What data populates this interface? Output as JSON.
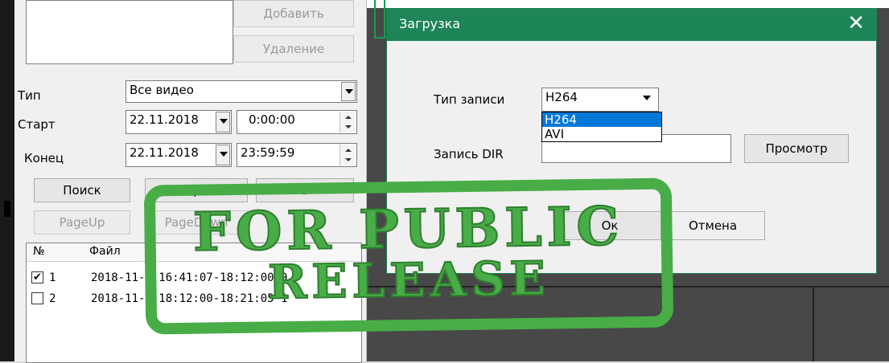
{
  "left_panel": {
    "add_button": "Добавить",
    "delete_button": "Удаление",
    "type_label": "Тип",
    "type_value": "Все видео",
    "start_label": "Старт",
    "start_date": "22.11.2018",
    "start_time": "0:00:00",
    "end_label": "Конец",
    "end_date": "22.11.2018",
    "end_time": "23:59:59",
    "search_button": "Поиск",
    "play_button": "Воспроизв",
    "third_button": "В",
    "page_up": "PageUp",
    "page_down": "PageDown",
    "list": {
      "col_no": "№",
      "col_file": "Файл",
      "rows": [
        {
          "no": "1",
          "checked": true,
          "checkmark": "✔",
          "file": "2018-11-2 16:41:07-18:12:00 9"
        },
        {
          "no": "2",
          "checked": false,
          "checkmark": "",
          "file": "2018-11-2 18:12:00-18:21:05 1"
        }
      ]
    }
  },
  "dialog": {
    "title": "Загрузка",
    "close_icon": "✕",
    "record_type_label": "Тип записи",
    "record_type_value": "H264",
    "dropdown_options": [
      "H264",
      "AVI"
    ],
    "record_dir_label": "Запись DIR",
    "record_dir_value": "",
    "browse_button": "Просмотр",
    "ok_button": "Ок",
    "cancel_button": "Отмена"
  },
  "stamp": {
    "line1": "FOR PUBLIC",
    "line2": "RELEASE",
    "color": "#48ad47"
  }
}
